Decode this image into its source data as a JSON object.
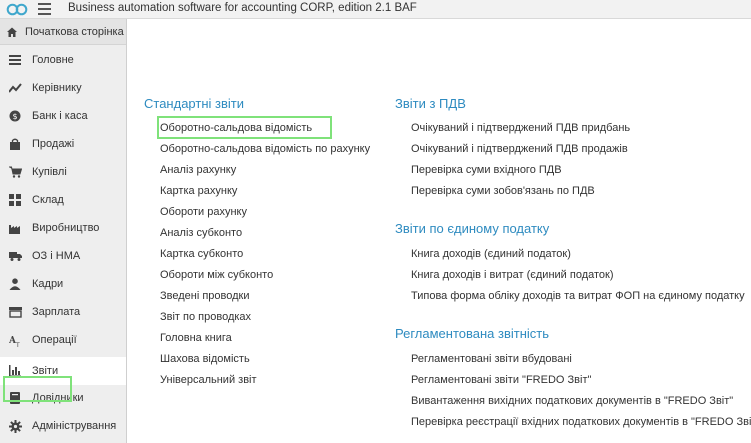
{
  "app": {
    "title": "Business automation software for accounting CORP, edition 2.1 BAF"
  },
  "sidebar": {
    "home_label": "Початкова сторінка",
    "items": [
      {
        "label": "Головне",
        "icon": "menu-lines-icon"
      },
      {
        "label": "Керівнику",
        "icon": "trend-chart-icon"
      },
      {
        "label": "Банк і каса",
        "icon": "coin-icon"
      },
      {
        "label": "Продажі",
        "icon": "shopping-bag-icon"
      },
      {
        "label": "Купівлі",
        "icon": "cart-icon"
      },
      {
        "label": "Склад",
        "icon": "grid-icon"
      },
      {
        "label": "Виробництво",
        "icon": "factory-icon"
      },
      {
        "label": "ОЗ і НМА",
        "icon": "truck-icon"
      },
      {
        "label": "Кадри",
        "icon": "person-icon"
      },
      {
        "label": "Зарплата",
        "icon": "payroll-icon"
      },
      {
        "label": "Операції",
        "icon": "operations-icon"
      },
      {
        "label": "Звіти",
        "icon": "bar-chart-icon"
      },
      {
        "label": "Довідники",
        "icon": "book-icon"
      },
      {
        "label": "Адміністрування",
        "icon": "gear-icon"
      }
    ],
    "active": "Звіти"
  },
  "reports": {
    "standard": {
      "title": "Стандартні звіти",
      "items": [
        "Оборотно-сальдова відомість",
        "Оборотно-сальдова відомість по рахунку",
        "Аналіз рахунку",
        "Картка рахунку",
        "Обороти рахунку",
        "Аналіз субконто",
        "Картка субконто",
        "Обороти між субконто",
        "Зведені проводки",
        "Звіт по проводках",
        "Головна книга",
        "Шахова відомість",
        "Універсальний звіт"
      ]
    },
    "vat": {
      "title": "Звіти з ПДВ",
      "items": [
        "Очікуваний і підтверджений ПДВ придбань",
        "Очікуваний і підтверджений ПДВ продажів",
        "Перевірка суми вхідного ПДВ",
        "Перевірка суми зобов'язань по ПДВ"
      ]
    },
    "single_tax": {
      "title": "Звіти по єдиному податку",
      "items": [
        "Книга доходів (єдиний податок)",
        "Книга доходів і витрат (єдиний податок)",
        "Типова форма обліку доходів та витрат ФОП на єдиному податку"
      ]
    },
    "regulated": {
      "title": "Регламентована звітність",
      "items": [
        "Регламентовані звіти вбудовані",
        "Регламентовані звіти \"FREDO Звіт\"",
        "Вивантаження вихідних податкових документів в \"FREDO Звіт\"",
        "Перевірка реєстрації вхідних податкових документів в \"FREDO Звіт\""
      ]
    }
  },
  "colors": {
    "section_title": "#2e8bc0",
    "highlight_frame": "#7fe27a",
    "sidebar_bg": "#eeeeee"
  }
}
